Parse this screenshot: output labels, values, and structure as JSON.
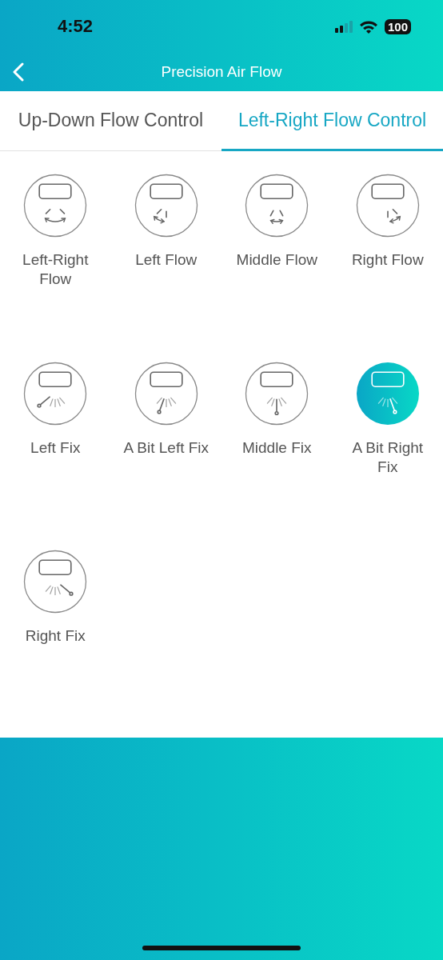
{
  "status_bar": {
    "time": "4:52",
    "battery": "100"
  },
  "header": {
    "title": "Precision Air Flow"
  },
  "tabs": [
    {
      "label": "Up-Down Flow Control",
      "selected": false
    },
    {
      "label": "Left-Right Flow Control",
      "selected": true
    }
  ],
  "modes": [
    {
      "label": "Left-Right Flow",
      "kind": "flow-all",
      "selected": false
    },
    {
      "label": "Left Flow",
      "kind": "flow-left",
      "selected": false
    },
    {
      "label": "Middle Flow",
      "kind": "flow-middle",
      "selected": false
    },
    {
      "label": "Right Flow",
      "kind": "flow-right",
      "selected": false
    },
    {
      "label": "Left Fix",
      "kind": "fix-left",
      "selected": false
    },
    {
      "label": "A Bit Left Fix",
      "kind": "fix-slight-left",
      "selected": false
    },
    {
      "label": "Middle Fix",
      "kind": "fix-middle",
      "selected": false
    },
    {
      "label": "A Bit Right Fix",
      "kind": "fix-slight-right",
      "selected": true
    },
    {
      "label": "Right Fix",
      "kind": "fix-right",
      "selected": false
    }
  ]
}
